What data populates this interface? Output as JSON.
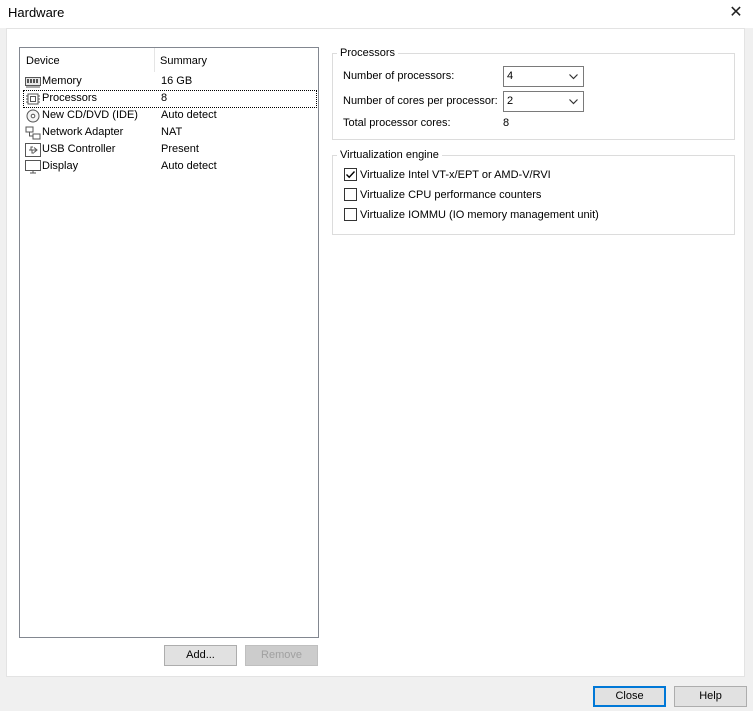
{
  "window": {
    "title": "Hardware",
    "close_glyph": "✕"
  },
  "device_list": {
    "columns": {
      "device": "Device",
      "summary": "Summary"
    },
    "items": [
      {
        "name": "Memory",
        "summary": "16 GB",
        "icon": "memory-icon"
      },
      {
        "name": "Processors",
        "summary": "8",
        "icon": "processor-icon",
        "selected": true
      },
      {
        "name": "New CD/DVD (IDE)",
        "summary": "Auto detect",
        "icon": "cd-dvd-icon"
      },
      {
        "name": "Network Adapter",
        "summary": "NAT",
        "icon": "network-icon"
      },
      {
        "name": "USB Controller",
        "summary": "Present",
        "icon": "usb-icon"
      },
      {
        "name": "Display",
        "summary": "Auto detect",
        "icon": "display-icon"
      }
    ]
  },
  "buttons": {
    "add": "Add...",
    "remove": "Remove",
    "close": "Close",
    "help": "Help"
  },
  "processors": {
    "title": "Processors",
    "num_processors_label": "Number of processors:",
    "num_processors_value": "4",
    "cores_label": "Number of cores per processor:",
    "cores_value": "2",
    "total_label": "Total processor cores:",
    "total_value": "8"
  },
  "virtualization": {
    "title": "Virtualization engine",
    "options": [
      {
        "label": "Virtualize Intel VT-x/EPT or AMD-V/RVI",
        "checked": true
      },
      {
        "label": "Virtualize CPU performance counters",
        "checked": false
      },
      {
        "label": "Virtualize IOMMU (IO memory management unit)",
        "checked": false
      }
    ]
  },
  "colors": {
    "accent": "#0078d7",
    "background": "#f0f0f0",
    "panel": "#ffffff"
  }
}
